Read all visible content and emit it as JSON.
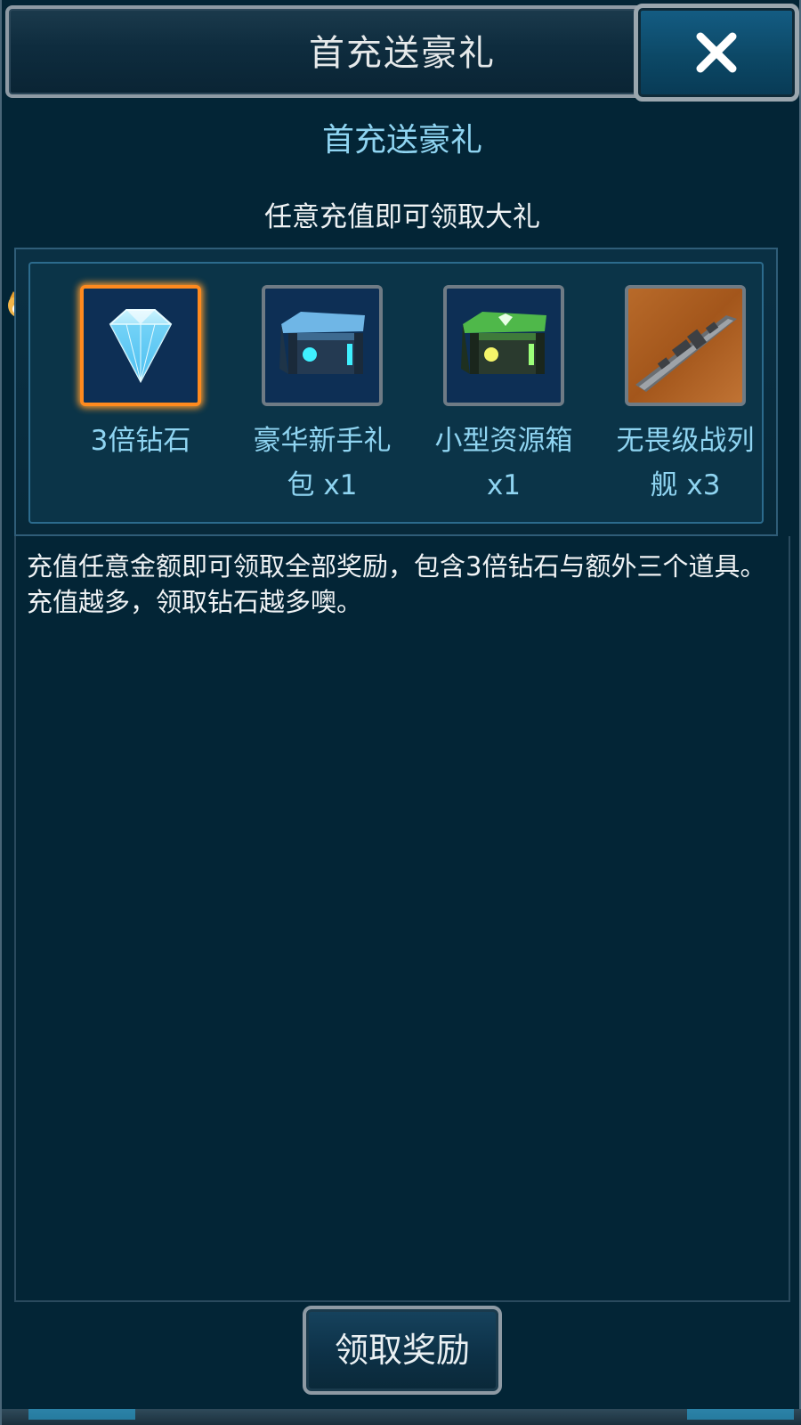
{
  "header": {
    "title": "首充送豪礼",
    "close_icon": "close-icon"
  },
  "panel": {
    "subtitle": "首充送豪礼",
    "tagline": "任意充值即可领取大礼"
  },
  "rewards": [
    {
      "label": "3倍钻石",
      "icon": "diamond-icon",
      "selected": true
    },
    {
      "label": "豪华新手礼包 x1",
      "icon": "blue-crate-icon",
      "selected": false
    },
    {
      "label": "小型资源箱 x1",
      "icon": "green-crate-icon",
      "selected": false
    },
    {
      "label": "无畏级战列舰 x3",
      "icon": "battleship-icon",
      "selected": false
    }
  ],
  "description": {
    "line1": "充值任意金额即可领取全部奖励，包含3倍钻石与额外三个道具。",
    "line2": "充值越多，领取钻石越多噢。"
  },
  "claim_button": {
    "label": "领取奖励"
  },
  "colors": {
    "accent_text": "#8fd4f1",
    "selected_border": "#ff8a1e",
    "background": "#032536"
  }
}
